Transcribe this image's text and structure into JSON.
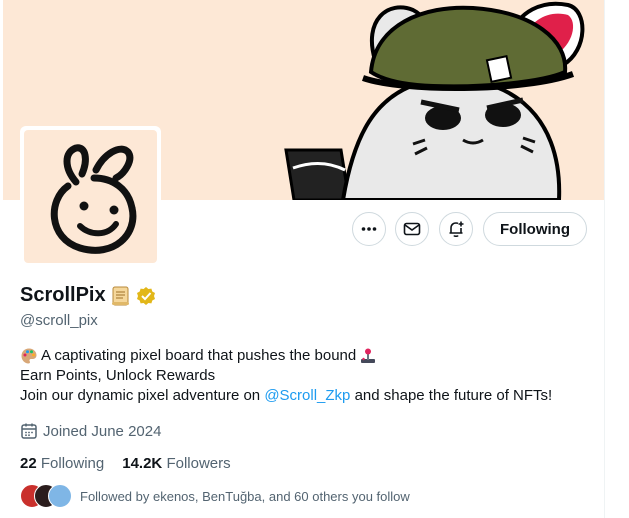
{
  "profile": {
    "display_name": "ScrollPix",
    "handle": "@scroll_pix",
    "verified_badge": "verified-gold-badge-icon",
    "name_emoji": "scroll-icon"
  },
  "actions": {
    "more_icon": "more-icon",
    "message_icon": "mail-icon",
    "notify_icon": "bell-plus-icon",
    "following_label": "Following"
  },
  "bio": {
    "line1_text": "A captivating pixel board that pushes the bound",
    "line1_prefix_icon": "palette-icon",
    "line1_suffix_icon": "joystick-icon",
    "line2_text": "Earn Points, Unlock Rewards",
    "line3_before": "Join our dynamic pixel adventure on ",
    "line3_mention": "@Scroll_Zkp",
    "line3_after": " and shape the future of NFTs!"
  },
  "joined": {
    "text": "Joined June 2024",
    "icon": "calendar-icon"
  },
  "stats": {
    "following_count": "22",
    "following_label": "Following",
    "followers_count": "14.2K",
    "followers_label": "Followers"
  },
  "followed_by": {
    "text": "Followed by ekenos, BenTuğba, and 60 others you follow"
  },
  "colors": {
    "banner": "#fde8d6",
    "accent_link": "#1d9bf0",
    "secondary_text": "#536471",
    "border": "#cfd9de"
  }
}
